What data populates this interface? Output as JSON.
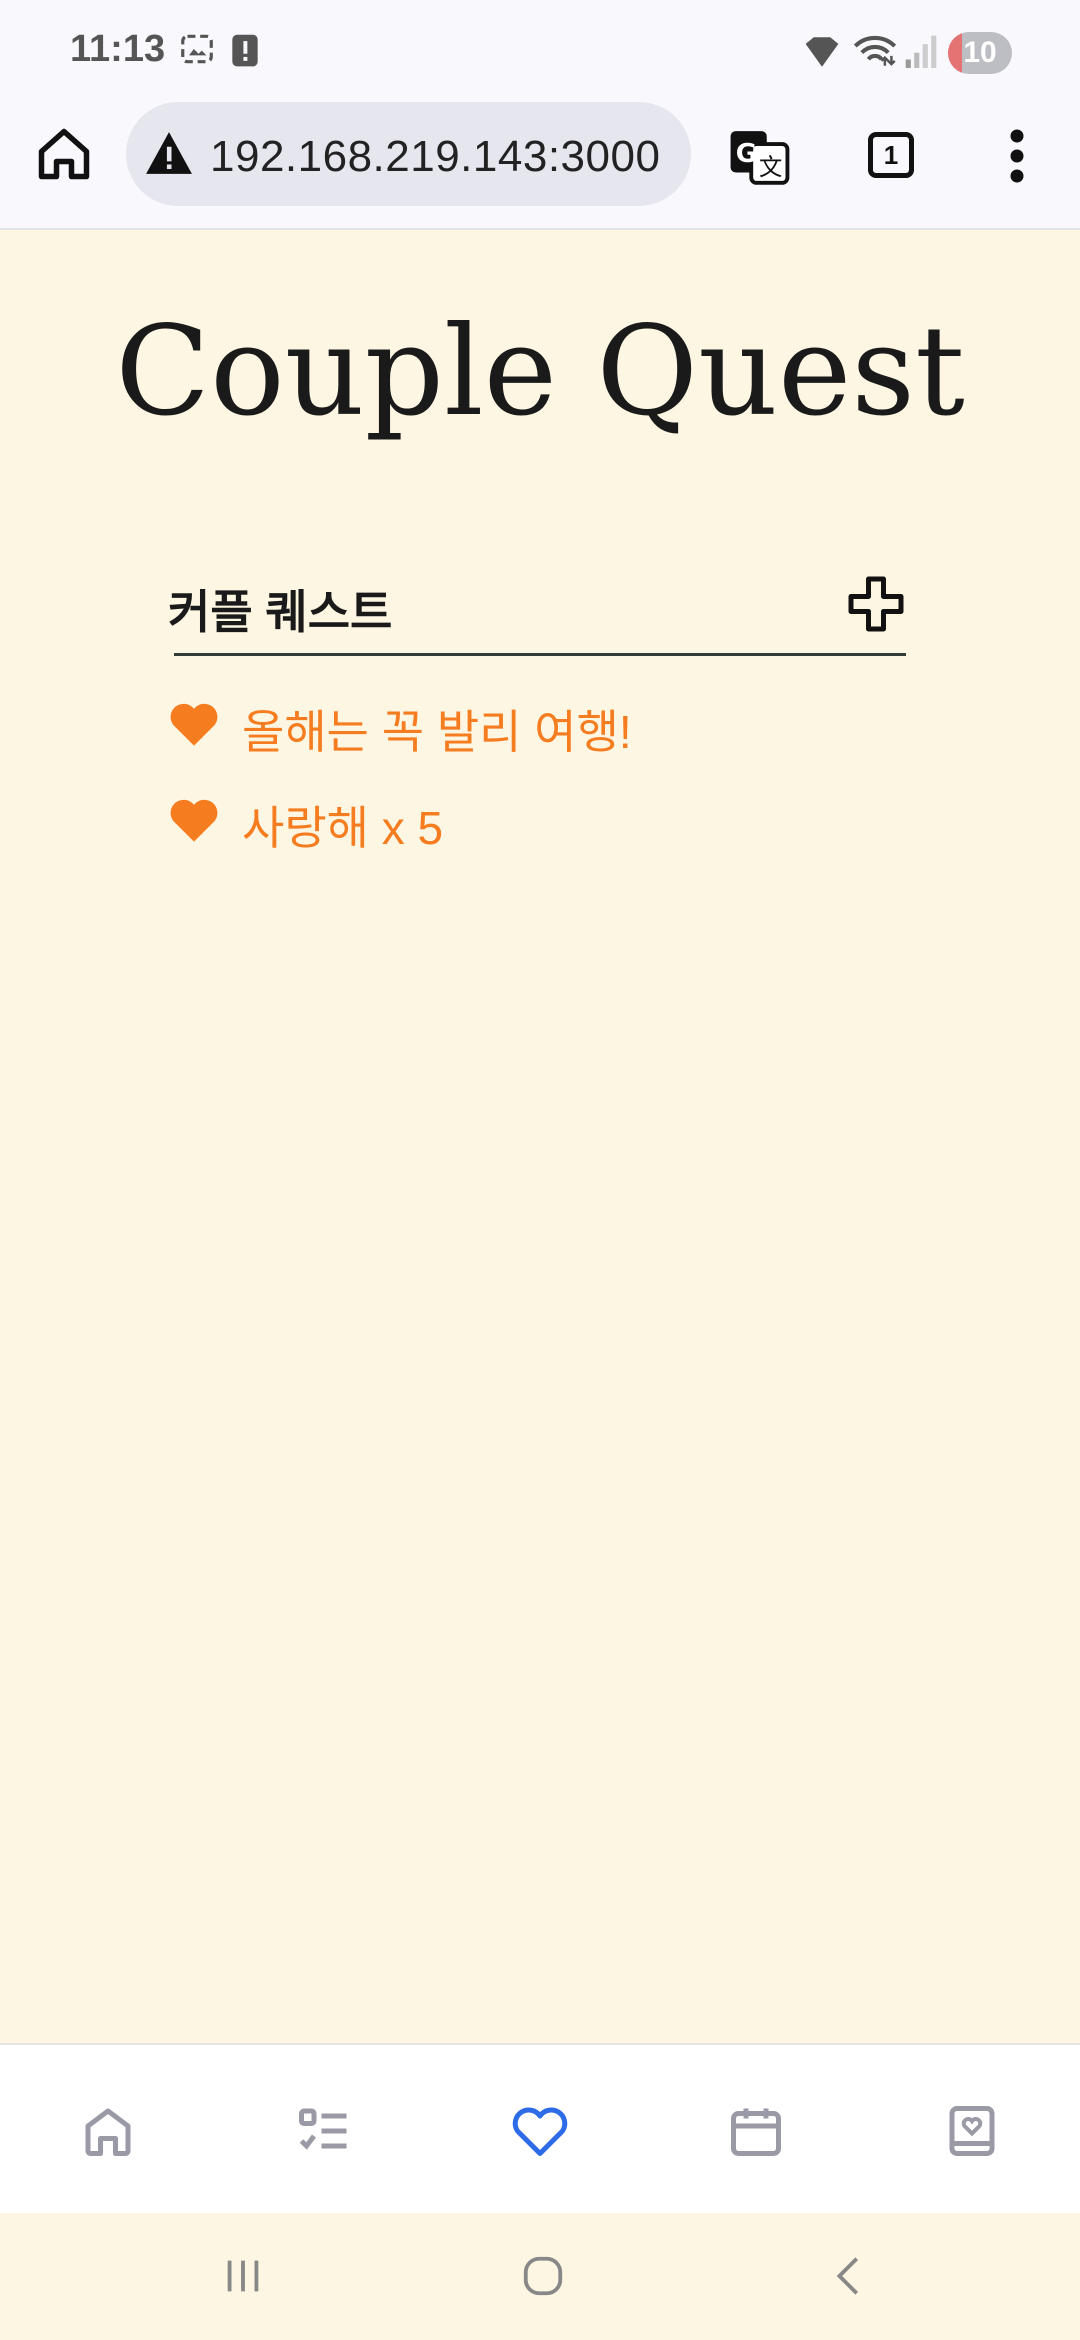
{
  "status_bar": {
    "time": "11:13",
    "battery_level": "10",
    "icons": [
      "screenshot-icon",
      "alert-icon",
      "vpn-icon",
      "wifi-icon",
      "signal-icon"
    ]
  },
  "browser": {
    "url": "192.168.219.143:3000",
    "tab_count": "1",
    "icons": [
      "home-icon",
      "warning-icon",
      "translate-icon",
      "more-vert-icon"
    ]
  },
  "page": {
    "title": "Couple Quest",
    "section_title": "커플 퀘스트",
    "accent_color": "#f57c1f",
    "quests": [
      {
        "label": "올해는 꼭 발리 여행!",
        "icon": "heart-icon"
      },
      {
        "label": "사랑해 x 5",
        "icon": "heart-icon"
      }
    ]
  },
  "bottom_nav": {
    "items": [
      {
        "name": "home",
        "icon": "home-outline-icon",
        "active": false
      },
      {
        "name": "checklist",
        "icon": "checklist-icon",
        "active": false
      },
      {
        "name": "quest",
        "icon": "heart-outline-icon",
        "active": true
      },
      {
        "name": "calendar",
        "icon": "calendar-icon",
        "active": false
      },
      {
        "name": "diary",
        "icon": "heart-book-icon",
        "active": false
      }
    ],
    "active_color": "#2e6be6",
    "inactive_color": "#9a9aa6"
  },
  "system_nav": {
    "icons": [
      "recents-icon",
      "home-circle-icon",
      "back-icon"
    ]
  }
}
